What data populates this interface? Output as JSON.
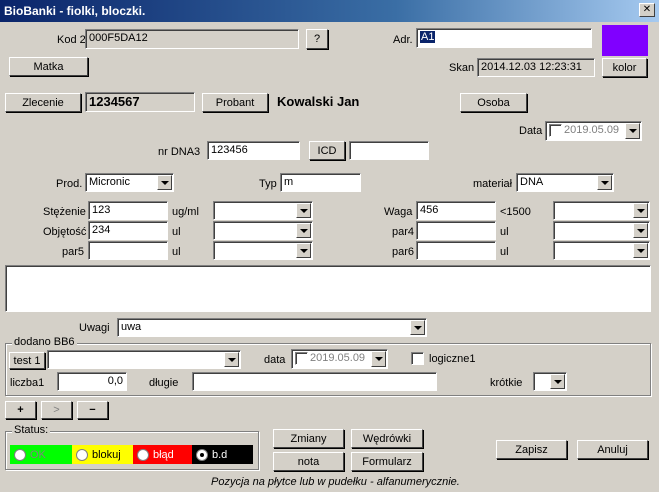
{
  "window": {
    "title": "BioBanki - fiolki, bloczki.",
    "close_label": "✕"
  },
  "kod2d": {
    "label": "Kod 2D",
    "value": "000F5DA12",
    "help_label": "?"
  },
  "adr": {
    "label": "Adr.",
    "value": "A1"
  },
  "color_swatch": "#8000ff",
  "matka_label": "Matka",
  "skan": {
    "label": "Skan",
    "value": "2014.12.03 12:23:31"
  },
  "kolor_label": "kolor",
  "zlecenie": {
    "label": "Zlecenie",
    "value": "1234567"
  },
  "probant": {
    "label": "Probant",
    "value": "Kowalski Jan"
  },
  "osoba_label": "Osoba",
  "data": {
    "label": "Data",
    "value": "2019.05.09"
  },
  "nrdna": {
    "label": "nr DNA3",
    "value": "123456",
    "icd_label": "ICD",
    "icd_value": ""
  },
  "prod": {
    "label": "Prod.",
    "value": "Micronic"
  },
  "typ": {
    "label": "Typ",
    "value": "m"
  },
  "material": {
    "label": "materiał",
    "value": "DNA"
  },
  "stezenie": {
    "label": "Stężenie",
    "value": "123",
    "unit": "ug/ml"
  },
  "objetosc": {
    "label": "Objętość",
    "value": "234",
    "unit": "ul"
  },
  "par5": {
    "label": "par5",
    "value": "",
    "unit": "ul"
  },
  "waga": {
    "label": "Waga",
    "value": "456",
    "unit": "<1500"
  },
  "par4": {
    "label": "par4",
    "value": "",
    "unit": "ul"
  },
  "par6": {
    "label": "par6",
    "value": "",
    "unit": "ul"
  },
  "uwagi": {
    "label": "Uwagi",
    "value": "uwa"
  },
  "bb6": {
    "group_label": "dodano BB6",
    "test_label": "test 1",
    "data_label": "data",
    "data_value": "2019.05.09",
    "logiczne_label": "logiczne1",
    "liczba_label": "liczba1",
    "liczba_value": "0,0",
    "dlugie_label": "długie",
    "krotkie_label": "krótkie"
  },
  "nav": {
    "add": "+",
    "next": ">",
    "remove": "−"
  },
  "status": {
    "label": "Status:",
    "options": [
      {
        "label": "OK",
        "color": "#00ff00"
      },
      {
        "label": "blokuj",
        "color": "#ffff00"
      },
      {
        "label": "błąd",
        "color": "#ff0000"
      },
      {
        "label": "b.d",
        "color": "#000000"
      }
    ],
    "selected": "b.d"
  },
  "buttons": {
    "zmiany": "Zmiany",
    "wedrowki": "Wędrówki",
    "nota": "nota",
    "formularz": "Formularz",
    "zapisz": "Zapisz",
    "anuluj": "Anuluj"
  },
  "footer_hint": "Pozycja na płytce lub w pudełku - alfanumerycznie."
}
